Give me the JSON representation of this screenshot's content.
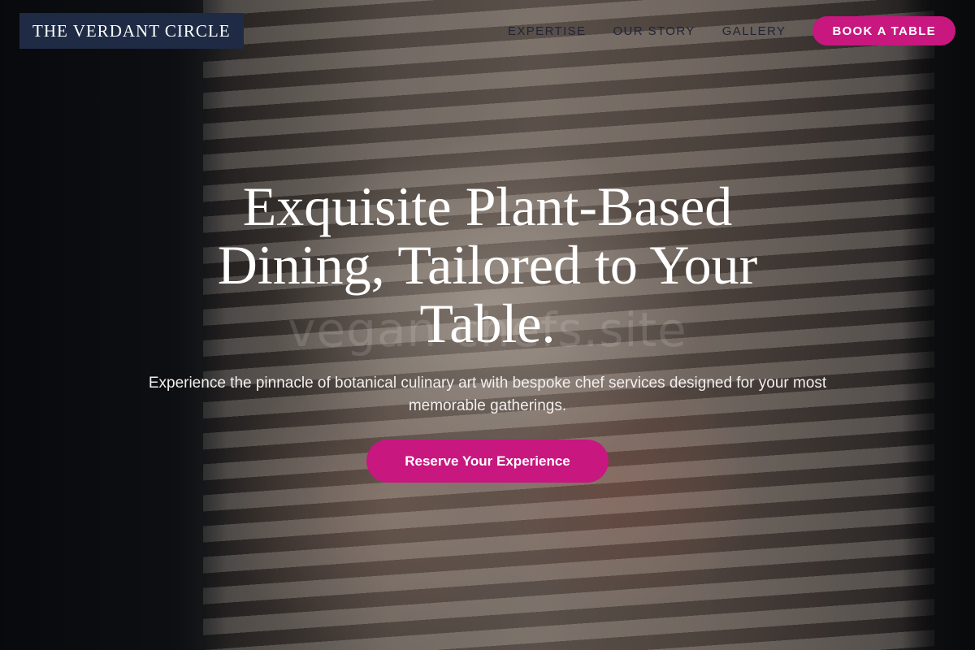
{
  "header": {
    "logo_text": "THE VERDANT CIRCLE",
    "nav": [
      {
        "label": "EXPERTISE"
      },
      {
        "label": "OUR STORY"
      },
      {
        "label": "GALLERY"
      }
    ],
    "cta_label": "BOOK A TABLE"
  },
  "hero": {
    "headline": "Exquisite Plant-Based Dining, Tailored to Your Table.",
    "subheadline": "Experience the pinnacle of botanical culinary art with bespoke chef services designed for your most memorable gatherings.",
    "cta_label": "Reserve Your Experience",
    "watermark": "vegan chefs.site"
  },
  "colors": {
    "accent": "#c8177f",
    "logo_bg": "#1f2b44",
    "nav_text": "#1f2436"
  }
}
